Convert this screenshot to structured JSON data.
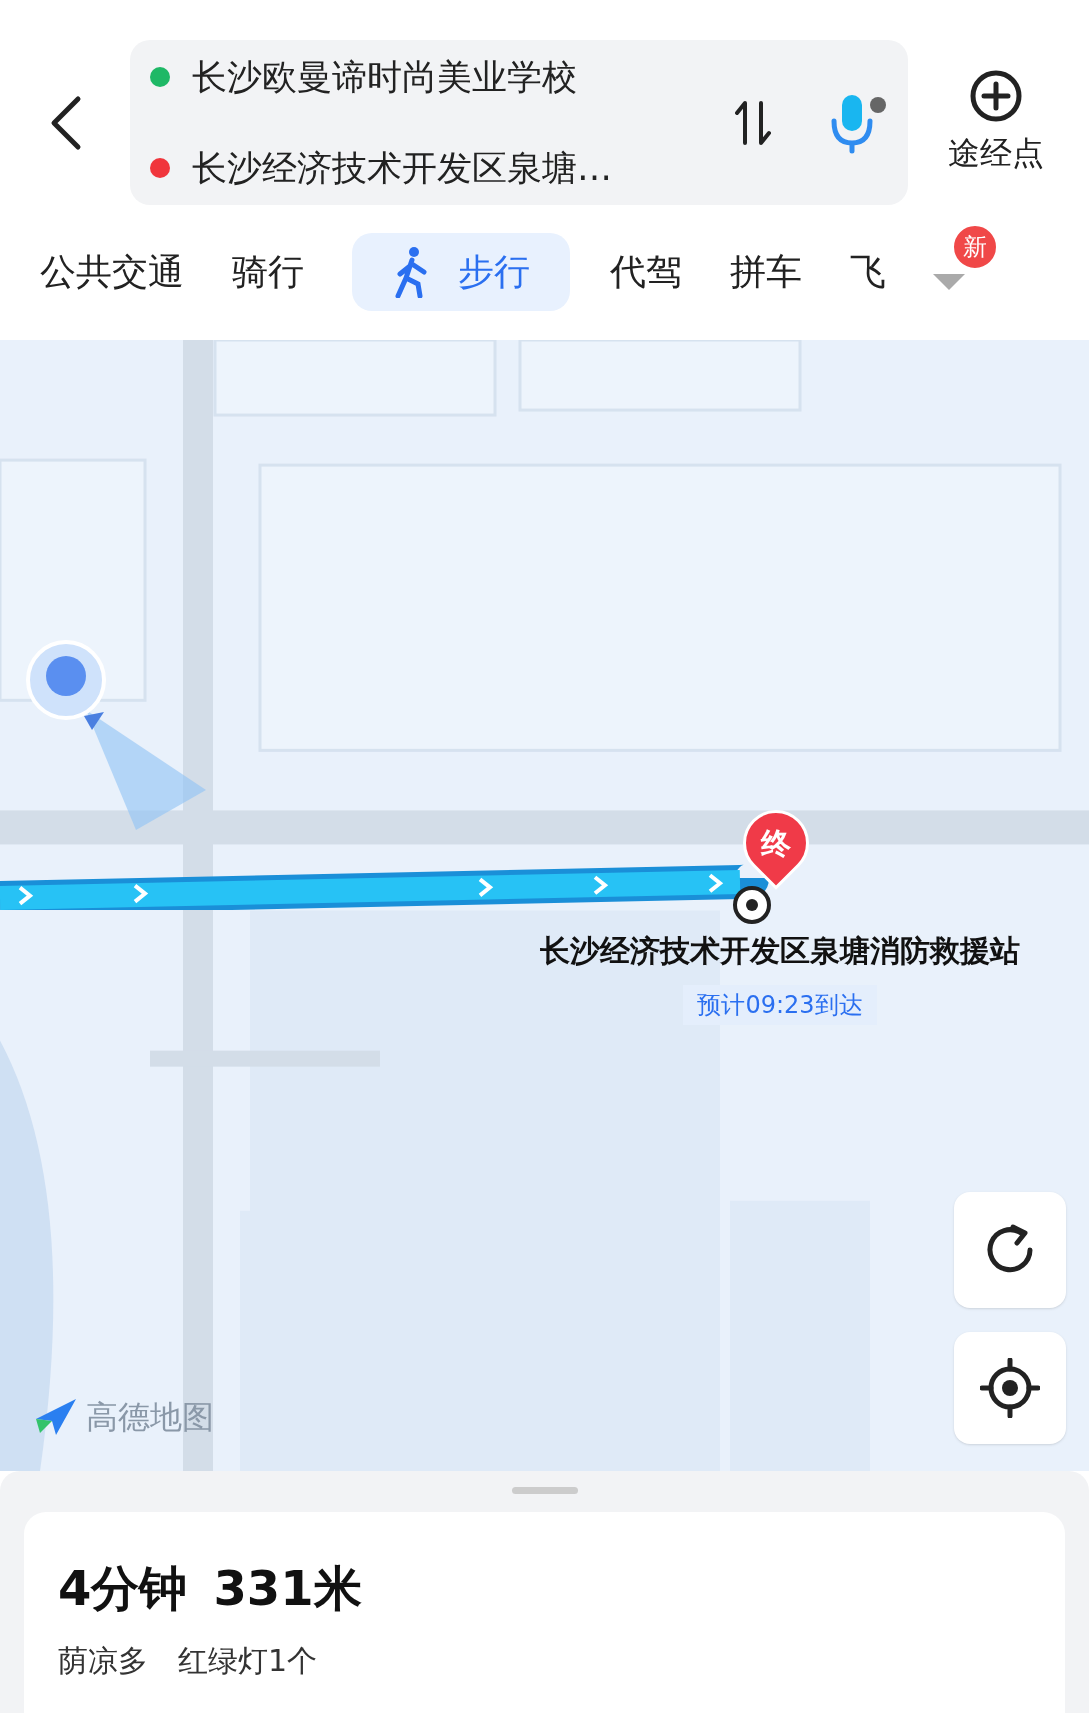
{
  "route": {
    "origin": "长沙欧曼谛时尚美业学校",
    "destination": "长沙经济技术开发区泉塘…"
  },
  "waypoint_button": "途经点",
  "modes": [
    {
      "label": "公共交通",
      "selected": false
    },
    {
      "label": "骑行",
      "selected": false
    },
    {
      "label": "步行",
      "selected": true
    },
    {
      "label": "代驾",
      "selected": false
    },
    {
      "label": "拼车",
      "selected": false
    },
    {
      "label": "飞",
      "selected": false
    }
  ],
  "more_badge": "新",
  "map": {
    "end_marker": "终",
    "destination_label": "长沙经济技术开发区泉塘消防救援站",
    "eta": "预计09:23到达",
    "logo": "高德地图"
  },
  "summary": {
    "duration": "4分钟",
    "distance": "331米",
    "tags": [
      "荫凉多",
      "红绿灯1个"
    ]
  }
}
